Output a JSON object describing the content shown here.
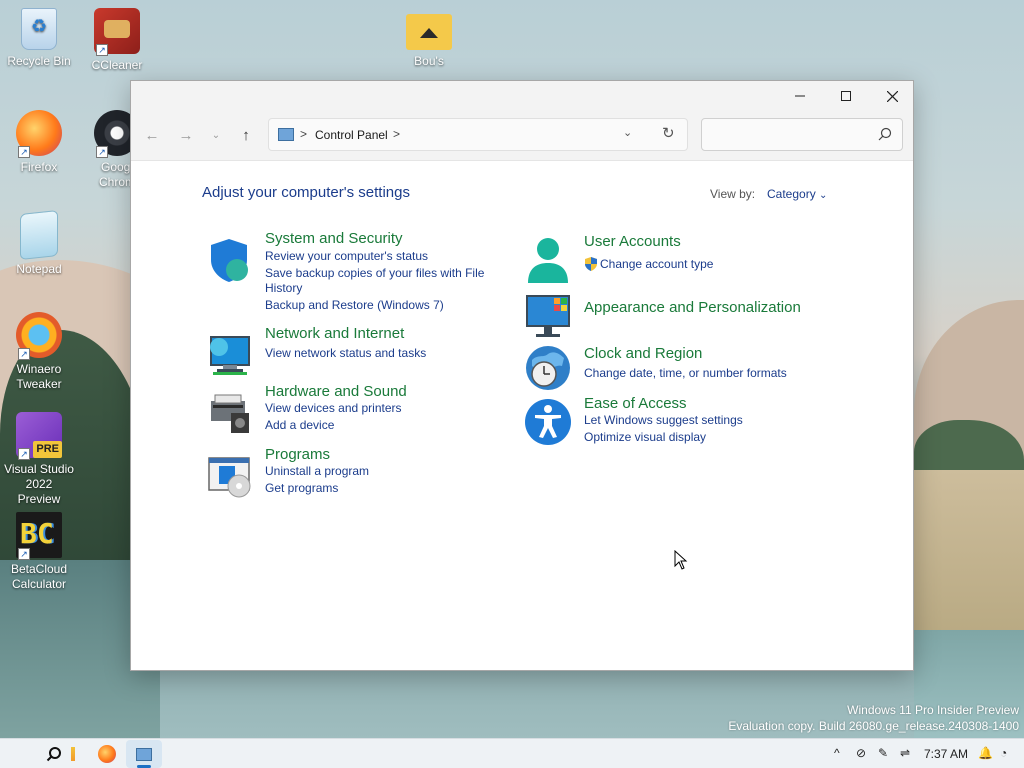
{
  "desktop": {
    "icons": [
      {
        "label": "Recycle Bin",
        "icon": "recycle-bin-icon"
      },
      {
        "label": "CCleaner",
        "icon": "ccleaner-icon"
      },
      {
        "label": "Bou's",
        "icon": "folder-icon"
      },
      {
        "label": "Firefox",
        "icon": "firefox-icon"
      },
      {
        "label": "Googl",
        "label2": "Chrom",
        "icon": "chrome-icon"
      },
      {
        "label": "Notepad",
        "icon": "notepad-icon"
      },
      {
        "label": "Winaero",
        "label2": "Tweaker",
        "icon": "winaero-icon"
      },
      {
        "label": "Visual Studio",
        "label2": "2022 Preview",
        "badge": "PRE",
        "icon": "visual-studio-icon"
      },
      {
        "label": "BetaCloud",
        "label2": "Calculator",
        "glyph": "BC",
        "icon": "betacloud-icon"
      }
    ],
    "watermark": {
      "line1": "Windows 11 Pro Insider Preview",
      "line2": "Evaluation copy. Build 26080.ge_release.240308-1400"
    }
  },
  "window": {
    "address": {
      "location": "Control Panel",
      "sep1": ">",
      "sep2": ">"
    },
    "search": {
      "placeholder": ""
    },
    "page_title": "Adjust your computer's settings",
    "view_by": {
      "label": "View by:",
      "value": "Category"
    },
    "categories_left": [
      {
        "title": "System and Security",
        "links": [
          "Review your computer's status",
          "Save backup copies of your files with File",
          "History",
          "Backup and Restore (Windows 7)"
        ]
      },
      {
        "title": "Network and Internet",
        "links": [
          "View network status and tasks"
        ]
      },
      {
        "title": "Hardware and Sound",
        "links": [
          "View devices and printers",
          "Add a device"
        ]
      },
      {
        "title": "Programs",
        "links": [
          "Uninstall a program",
          "Get programs"
        ]
      }
    ],
    "categories_right": [
      {
        "title": "User Accounts",
        "links": [
          "Change account type"
        ]
      },
      {
        "title": "Appearance and Personalization",
        "links": []
      },
      {
        "title": "Clock and Region",
        "links": [
          "Change date, time, or number formats"
        ]
      },
      {
        "title": "Ease of Access",
        "links": [
          "Let Windows suggest settings",
          "Optimize visual display"
        ]
      }
    ]
  },
  "taskbar": {
    "clock": "7:37 AM"
  },
  "colors": {
    "link": "#1c3d8c",
    "category_title": "#1a7a3a",
    "accent": "#1d70c4"
  }
}
